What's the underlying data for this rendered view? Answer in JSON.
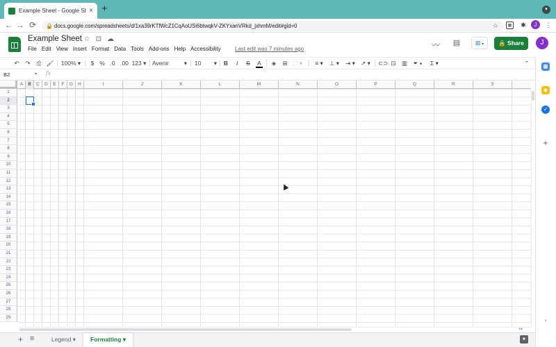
{
  "browser": {
    "tab_title": "Example Sheet - Google Sheets",
    "tab_close": "×",
    "new_tab": "+",
    "url": "docs.google.com/spreadsheets/d/1xa39rKTfWcZ1CqAoUSi6btwqkV-ZKYxanVRkd_jxhmM/edit#gid=0",
    "profile_initial": "J",
    "back": "←",
    "forward": "→",
    "reload": "⟳",
    "menu": "⋮"
  },
  "sheet": {
    "title": "Example Sheet",
    "menus": [
      "File",
      "Edit",
      "View",
      "Insert",
      "Format",
      "Data",
      "Tools",
      "Add-ons",
      "Help",
      "Accessibility"
    ],
    "last_edit": "Last edit was 7 minutes ago",
    "share_label": "Share",
    "user_initial": "J"
  },
  "toolbar": {
    "zoom": "100%",
    "currency": "$",
    "percent": "%",
    "decimal_decrease": ".0",
    "decimal_increase": ".00",
    "more_formats": "123",
    "font": "Avenir",
    "font_size": "10",
    "bold": "B",
    "italic": "I",
    "strike": "S",
    "text_color": "A",
    "sum": "Σ"
  },
  "formula_bar": {
    "name_box": "B2",
    "fx": "fx"
  },
  "grid": {
    "columns": [
      "A",
      "B",
      "C",
      "D",
      "E",
      "F",
      "G",
      "H",
      "I",
      "J",
      "K",
      "L",
      "M",
      "N",
      "O",
      "P",
      "Q",
      "R",
      "S"
    ],
    "rows": [
      "1",
      "2",
      "3",
      "4",
      "5",
      "6",
      "7",
      "8",
      "9",
      "10",
      "11",
      "12",
      "13",
      "14",
      "15",
      "16",
      "17",
      "18",
      "19",
      "20",
      "21",
      "22",
      "23",
      "24",
      "25",
      "26",
      "27",
      "28",
      "29"
    ],
    "selected_cell": "B2"
  },
  "sheet_tabs": {
    "tabs": [
      {
        "label": "Legend",
        "active": false
      },
      {
        "label": "Formatting",
        "active": true
      }
    ]
  },
  "colors": {
    "brand_green": "#188038",
    "selection_blue": "#1a73e8",
    "avatar_purple": "#8430ce",
    "tabstrip_teal": "#5fb8b8"
  }
}
